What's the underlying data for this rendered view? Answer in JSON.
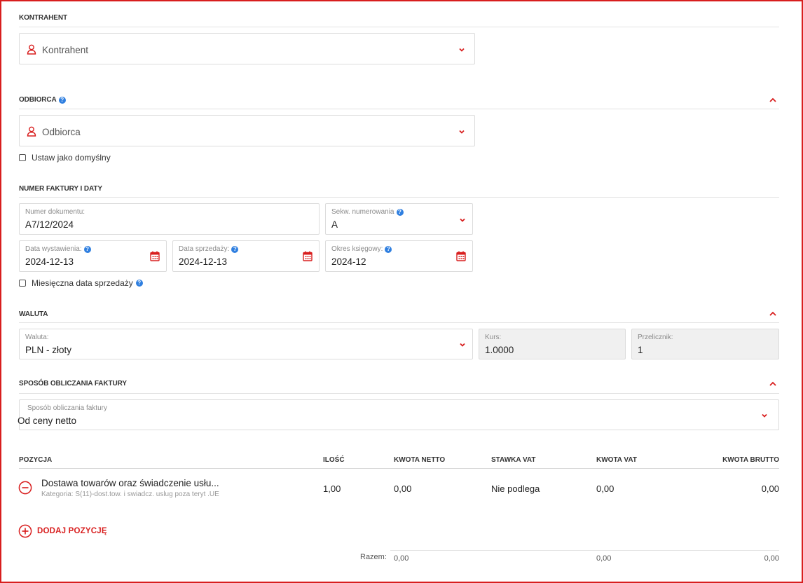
{
  "kontrahent": {
    "section_title": "KONTRAHENT",
    "placeholder": "Kontrahent"
  },
  "odbiorca": {
    "section_title": "ODBIORCA",
    "placeholder": "Odbiorca",
    "default_checkbox_label": "Ustaw jako domyślny",
    "default_checked": false
  },
  "numer": {
    "section_title": "NUMER FAKTURY I DATY",
    "numer_dokumentu": {
      "label": "Numer dokumentu:",
      "value": "A7/12/2024"
    },
    "sekw": {
      "label": "Sekw. numerowania",
      "value": "A"
    },
    "data_wystawienia": {
      "label": "Data wystawienia:",
      "value": "2024-12-13"
    },
    "data_sprzedazy": {
      "label": "Data sprzedaży:",
      "value": "2024-12-13"
    },
    "okres": {
      "label": "Okres księgowy:",
      "value": "2024-12"
    },
    "monthly_checkbox_label": "Miesięczna data sprzedaży",
    "monthly_checked": false
  },
  "waluta": {
    "section_title": "WALUTA",
    "waluta": {
      "label": "Waluta:",
      "value": "PLN - złoty"
    },
    "kurs": {
      "label": "Kurs:",
      "value": "1.0000"
    },
    "przelicznik": {
      "label": "Przelicznik:",
      "value": "1"
    }
  },
  "sposob": {
    "section_title": "SPOSÓB OBLICZANIA FAKTURY",
    "field": {
      "label": "Sposób obliczania faktury",
      "value": "Od ceny netto"
    }
  },
  "table": {
    "headers": {
      "pozycja": "POZYCJA",
      "ilosc": "ILOŚĆ",
      "netto": "KWOTA NETTO",
      "stawka": "STAWKA VAT",
      "vat": "KWOTA VAT",
      "brutto": "KWOTA BRUTTO"
    },
    "rows": [
      {
        "name": "Dostawa towarów oraz świadczenie usłu...",
        "category": "Kategoria: S(11)-dost.tow. i swiadcz. uslug poza teryt .UE",
        "ilosc": "1,00",
        "netto": "0,00",
        "stawka": "Nie podlega",
        "vat": "0,00",
        "brutto": "0,00"
      }
    ],
    "add_label": "DODAJ POZYCJĘ",
    "totals": {
      "label": "Razem:",
      "netto": "0,00",
      "vat": "0,00",
      "brutto": "0,00"
    }
  },
  "help_glyph": "?",
  "colors": {
    "accent": "#d81e1e",
    "help": "#2f7fe0",
    "border": "#dcdcdc",
    "disabled_bg": "#f0f0f0"
  },
  "icons": [
    "person-icon",
    "chevron-down-icon",
    "chevron-up-icon",
    "help-icon",
    "calendar-icon",
    "minus-circle-icon",
    "plus-circle-icon"
  ]
}
